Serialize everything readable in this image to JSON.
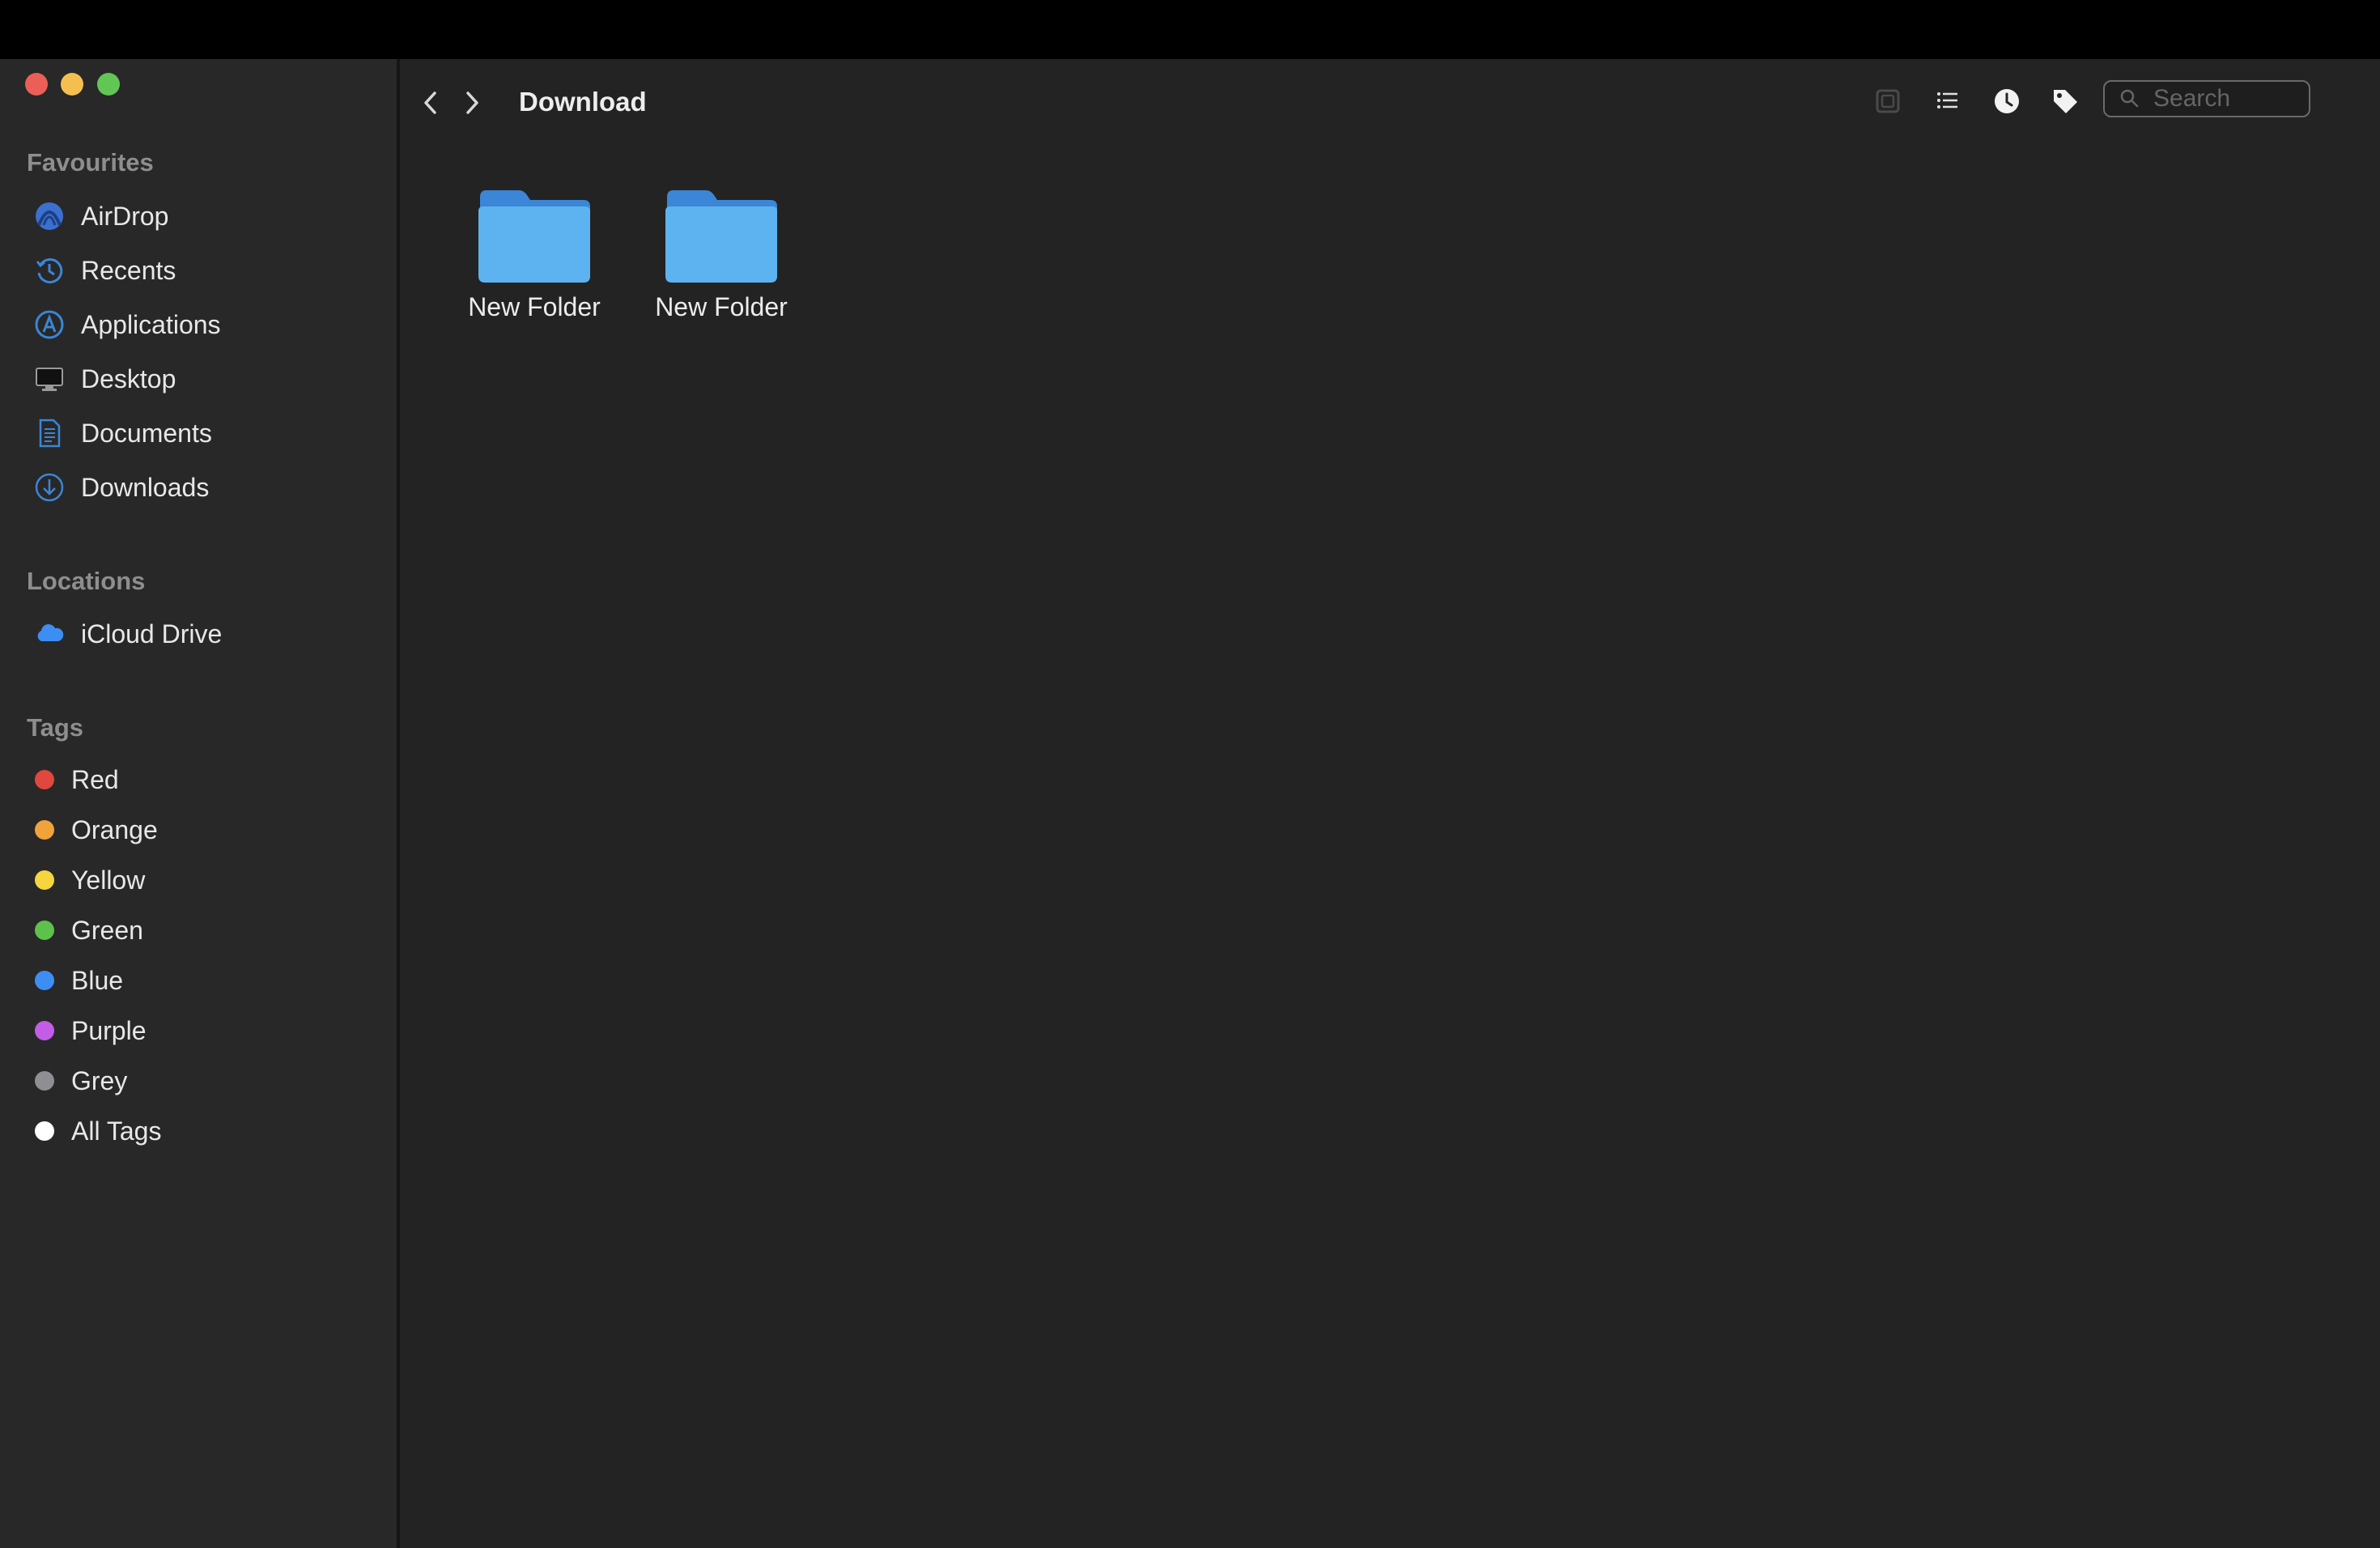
{
  "window": {
    "title": "Download"
  },
  "sidebar": {
    "favourites_title": "Favourites",
    "favourites": [
      {
        "label": "AirDrop",
        "icon": "airdrop-icon"
      },
      {
        "label": "Recents",
        "icon": "clock-icon"
      },
      {
        "label": "Applications",
        "icon": "applications-icon"
      },
      {
        "label": "Desktop",
        "icon": "desktop-icon"
      },
      {
        "label": "Documents",
        "icon": "document-icon"
      },
      {
        "label": "Downloads",
        "icon": "download-icon"
      }
    ],
    "locations_title": "Locations",
    "locations": [
      {
        "label": "iCloud Drive",
        "icon": "cloud-icon"
      }
    ],
    "tags_title": "Tags",
    "tags": [
      {
        "label": "Red",
        "color": "#e0483e"
      },
      {
        "label": "Orange",
        "color": "#f0a33b"
      },
      {
        "label": "Yellow",
        "color": "#f5d63e"
      },
      {
        "label": "Green",
        "color": "#5ec14b"
      },
      {
        "label": "Blue",
        "color": "#3d8ef2"
      },
      {
        "label": "Purple",
        "color": "#c35ce6"
      },
      {
        "label": "Grey",
        "color": "#8f8f93"
      },
      {
        "label": "All Tags",
        "color": "#ffffff"
      }
    ]
  },
  "toolbar": {
    "search_placeholder": "Search"
  },
  "files": [
    {
      "name": "New Folder",
      "icon": "folder-icon"
    },
    {
      "name": "New Folder",
      "icon": "folder-icon"
    }
  ],
  "colors": {
    "accent": "#3b86d6",
    "folder": "#5db3f0",
    "sidebar_bg": "#282828",
    "content_bg": "#232323"
  }
}
